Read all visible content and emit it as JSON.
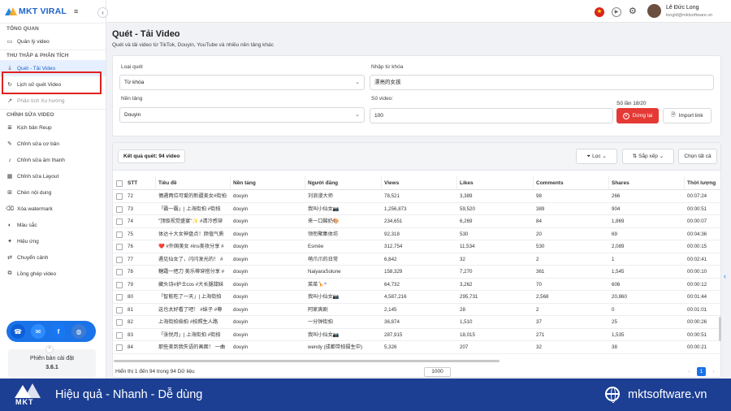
{
  "brand": {
    "name": "MKT VIRAL"
  },
  "sidebar": {
    "sections": [
      {
        "title": "TỔNG QUAN",
        "items": [
          {
            "label": "Quản lý video",
            "icon": "folder-icon"
          }
        ]
      },
      {
        "title": "THU THẬP & PHÂN TÍCH",
        "items": [
          {
            "label": "Quét - Tải Video",
            "icon": "download-icon",
            "active": true
          },
          {
            "label": "Lịch sử quét Video",
            "icon": "history-icon"
          },
          {
            "label": "Phân tích Xu hướng",
            "icon": "trend-icon",
            "muted": true
          }
        ]
      },
      {
        "title": "CHỈNH SỬA VIDEO",
        "items": [
          {
            "label": "Kịch bản Reup",
            "icon": "script-icon"
          },
          {
            "label": "Chỉnh sửa cơ bản",
            "icon": "edit-icon"
          },
          {
            "label": "Chỉnh sửa âm thanh",
            "icon": "audio-icon"
          },
          {
            "label": "Chỉnh sửa Layout",
            "icon": "layout-icon"
          },
          {
            "label": "Chèn nội dung",
            "icon": "insert-icon"
          },
          {
            "label": "Xóa watermark",
            "icon": "eraser-icon"
          },
          {
            "label": "Màu sắc",
            "icon": "palette-icon"
          },
          {
            "label": "Hiệu ứng",
            "icon": "effect-icon"
          },
          {
            "label": "Chuyển cảnh",
            "icon": "transition-icon"
          },
          {
            "label": "Lồng ghép video",
            "icon": "merge-icon"
          }
        ]
      }
    ],
    "version_label": "Phiên bản cài đặt",
    "version": "3.6.1"
  },
  "user": {
    "name": "Lê Đức Long",
    "email": "longld@mktsoftware.vn"
  },
  "page": {
    "title": "Quét - Tải Video",
    "subtitle": "Quét và tải video từ TikTok, Douyin, YouTube và nhiều nền tảng khác"
  },
  "form": {
    "scan_type_label": "Loại quét",
    "scan_type_value": "Từ khóa",
    "keyword_label": "Nhập từ khóa",
    "keyword_value": "漂亮的女孩",
    "platform_label": "Nền tảng",
    "platform_value": "Douyin",
    "video_count_label": "Số video:",
    "video_count_value": "100",
    "scan_times": "Số lần 18/20",
    "stop_label": "Dừng lại",
    "import_label": "Import link"
  },
  "results": {
    "count_label": "Kết quả quét: 94 video",
    "filter_label": "Lọc",
    "sort_label": "Sắp xếp",
    "select_all_label": "Chọn tất cả",
    "columns": [
      "STT",
      "Tiêu đề",
      "Nền tảng",
      "Người đăng",
      "Views",
      "Likes",
      "Comments",
      "Shares",
      "Thời lượng"
    ],
    "rows": [
      [
        "72",
        "偶遇两位可爱的新疆美女#街拍",
        "douyin",
        "刘浪漫大师",
        "78,521",
        "3,389",
        "98",
        "266",
        "00:07:24"
      ],
      [
        "73",
        "「霸一霸」| 上海街拍 #街拍",
        "douyin",
        "我叫小仙女📷",
        "1,256,873",
        "59,520",
        "389",
        "904",
        "00:00:51"
      ],
      [
        "74",
        "\"顶级视觉盛宴\"✨ #清冷感穿",
        "douyin",
        "来一口酸奶🎨",
        "234,651",
        "6,269",
        "84",
        "1,869",
        "00:00:07"
      ],
      [
        "75",
        "体达十大女神盘点！颜值气质",
        "douyin",
        "领衔聚集体坊",
        "92,318",
        "530",
        "20",
        "69",
        "00:04:36"
      ],
      [
        "76",
        "❤️ #外国美女 #ins美妆分享 #",
        "douyin",
        "Esmée",
        "312,754",
        "11,534",
        "530",
        "2,089",
        "00:00:15"
      ],
      [
        "77",
        "遇见仙女了，闪闪发光的！ #",
        "douyin",
        "萌爪爪的日常",
        "6,842",
        "32",
        "2",
        "1",
        "00:02:41"
      ],
      [
        "78",
        "糖霜一把刀 美乐蒂穿搭分享 #",
        "douyin",
        "NaiyaraSolune",
        "158,329",
        "7,270",
        "361",
        "1,545",
        "00:00:10"
      ],
      [
        "79",
        "藏头诗#护士cos #大长腿甜妹",
        "douyin",
        "菜菜🦒^",
        "64,732",
        "3,262",
        "70",
        "606",
        "00:00:12"
      ],
      [
        "80",
        "「智能吃了一天」| 上海街拍",
        "douyin",
        "我叫小仙女📷",
        "4,587,216",
        "295,731",
        "2,568",
        "20,860",
        "00:01:44"
      ],
      [
        "81",
        "这也太好看了吧！ #妹子 #尊",
        "douyin",
        "阿家爽剧",
        "2,145",
        "28",
        "2",
        "0",
        "00:01:01"
      ],
      [
        "82",
        "上海街拍偷拍 #拍照生人路",
        "douyin",
        "一分钟街拍",
        "36,874",
        "1,510",
        "37",
        "25",
        "00:00:26"
      ],
      [
        "83",
        "「张悦月」| 上海街拍 #街拍",
        "douyin",
        "我叫小仙女📷",
        "287,915",
        "18,015",
        "271",
        "1,535",
        "00:00:51"
      ],
      [
        "84",
        "那些美到我失语的画面！ 一曲",
        "douyin",
        "wendy (成都带拍摄生中)",
        "5,326",
        "207",
        "32",
        "38",
        "00:00:21"
      ]
    ],
    "footer_info": "Hiển thị 1 đến 94 trong 94 Dữ liệu",
    "page_size": "1000",
    "page_current": "1"
  },
  "banner": {
    "mark": "MKT",
    "slogan": "Hiệu quả - Nhanh - Dễ dùng",
    "site": "mktsoftware.vn"
  },
  "colors": {
    "primary": "#1a73e8",
    "danger": "#e53935",
    "banner": "#1c3f94",
    "active_bg": "#e6efff"
  }
}
